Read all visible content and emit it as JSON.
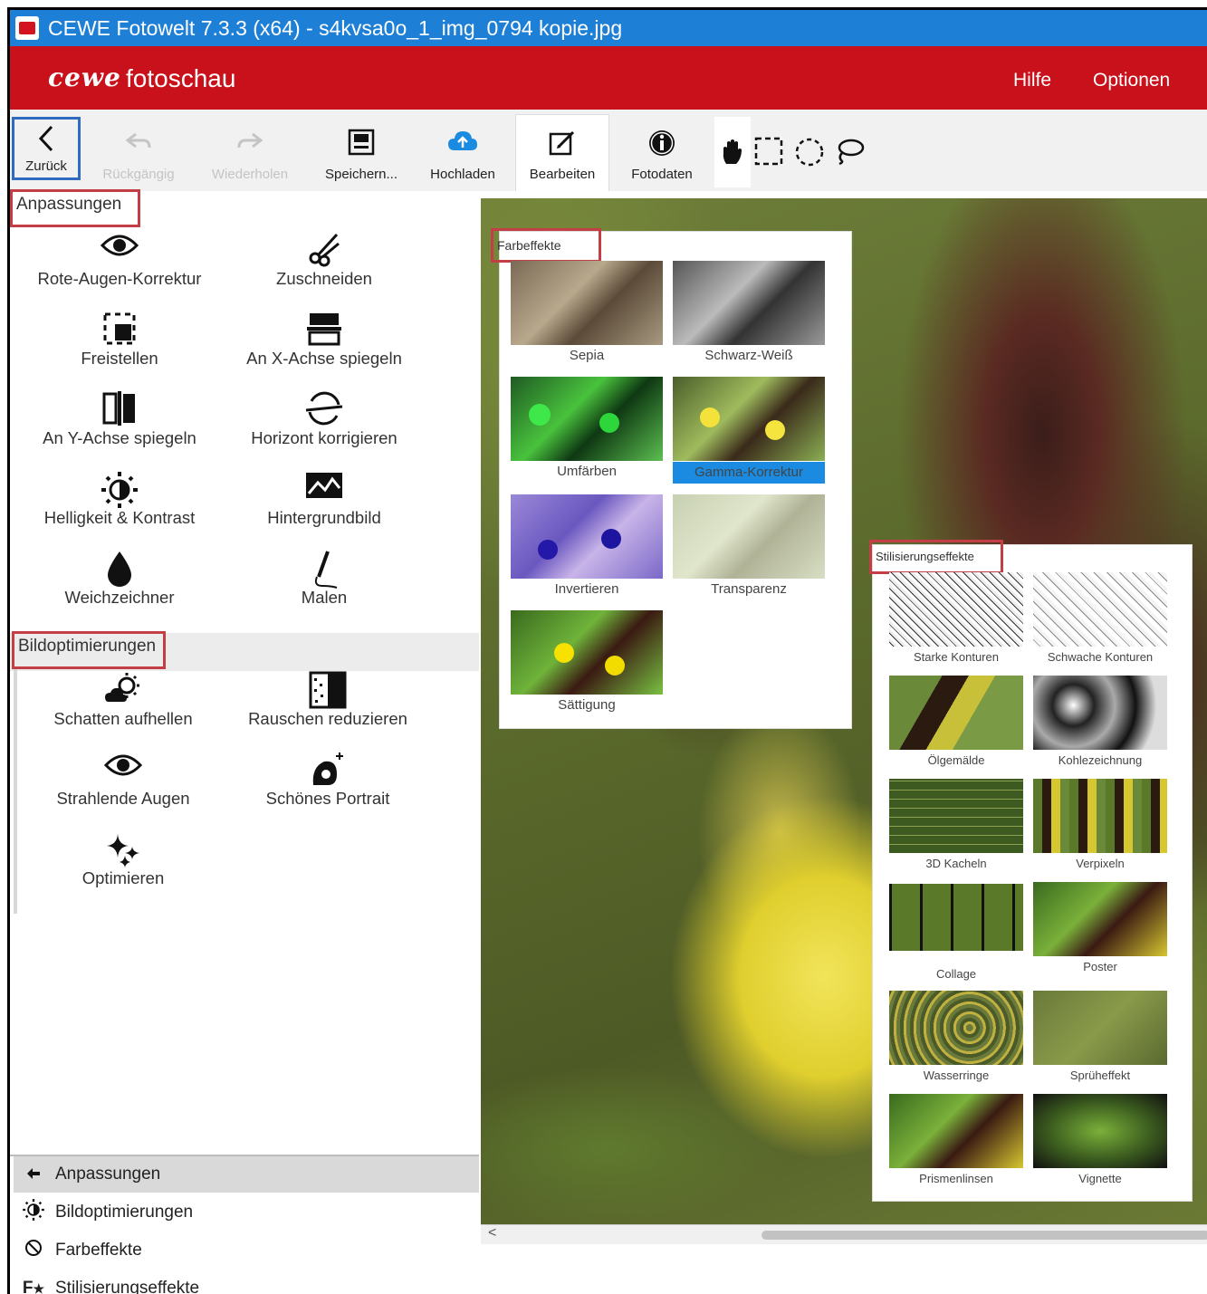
{
  "window": {
    "title": "CEWE Fotowelt 7.3.3 (x64) - s4kvsa0o_1_img_0794 kopie.jpg"
  },
  "brand": {
    "logo": "cewe",
    "name": "fotoschau",
    "help": "Hilfe",
    "options": "Optionen"
  },
  "toolbar": {
    "back": "Zurück",
    "undo": "Rückgängig",
    "redo": "Wiederholen",
    "save": "Speichern...",
    "upload": "Hochladen",
    "edit": "Bearbeiten",
    "photodata": "Fotodaten"
  },
  "adjustments": {
    "title": "Anpassungen",
    "items": [
      "Rote-Augen-Korrektur",
      "Zuschneiden",
      "Freistellen",
      "An X-Achse spiegeln",
      "An Y-Achse spiegeln",
      "Horizont korrigieren",
      "Helligkeit & Kontrast",
      "Hintergrundbild",
      "Weichzeichner",
      "Malen"
    ]
  },
  "optimizations": {
    "title": "Bildoptimierungen",
    "items": [
      "Schatten aufhellen",
      "Rauschen reduzieren",
      "Strahlende Augen",
      "Schönes Portrait",
      "Optimieren"
    ]
  },
  "nav": {
    "adjustments": "Anpassungen",
    "optimizations": "Bildoptimierungen",
    "coloreffects": "Farbeffekte",
    "stylize": "Stilisierungseffekte"
  },
  "coloreffects": {
    "title": "Farbeffekte",
    "items": [
      "Sepia",
      "Schwarz-Weiß",
      "Umfärben",
      "Gamma-Korrektur",
      "Invertieren",
      "Transparenz",
      "Sättigung"
    ],
    "selected": "Gamma-Korrektur"
  },
  "stylize": {
    "title": "Stilisierungseffekte",
    "items": [
      "Starke Konturen",
      "Schwache Konturen",
      "Ölgemälde",
      "Kohlezeichnung",
      "3D Kacheln",
      "Verpixeln",
      "Collage",
      "Poster",
      "Wasserringe",
      "Sprüheffekt",
      "Prismenlinsen",
      "Vignette"
    ]
  },
  "colors": {
    "brand": "#c8111b",
    "titlebar": "#1d7fd6",
    "highlight": "#c43f45",
    "selected": "#1a8be0"
  }
}
